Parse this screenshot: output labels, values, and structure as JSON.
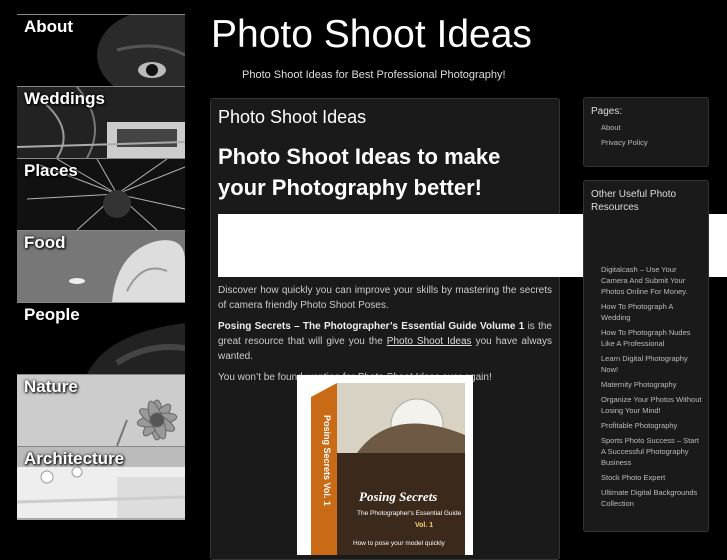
{
  "site": {
    "title": "Photo Shoot Ideas",
    "tagline": "Photo Shoot Ideas for Best Professional Photography!"
  },
  "leftnav": {
    "items": [
      {
        "label": "About",
        "icon": "eye-photo"
      },
      {
        "label": "Weddings",
        "icon": "wedding-photo"
      },
      {
        "label": "Places",
        "icon": "city-lights-photo"
      },
      {
        "label": "Food",
        "icon": "food-photo"
      },
      {
        "label": "People",
        "icon": "face-photo"
      },
      {
        "label": "Nature",
        "icon": "flower-photo"
      },
      {
        "label": "Architecture",
        "icon": "ceiling-photo"
      }
    ]
  },
  "main": {
    "post_title": "Photo Shoot Ideas",
    "headline": "Photo Shoot Ideas to make your Photography better!",
    "p1": "Discover how quickly you can improve your skills by mastering the secrets of camera friendly Photo Shoot Poses.",
    "p2_bold": "Posing Secrets – The Photographer’s Essential Guide Volume 1",
    "p2_mid": " is the great resource that will give you the ",
    "p2_link": "Photo Shoot Ideas",
    "p2_end": " you have always wanted.",
    "p3_start": "You won’t be found wanting for ",
    "p3_em": "Photo Shoot Ideas",
    "p3_end": " ever again!",
    "book": {
      "spine": "Posing Secrets Vol. 1",
      "title": "Posing Secrets",
      "subtitle": "The Photographer's Essential Guide",
      "vol": "Vol. 1",
      "tagline": "How to pose your model quickly"
    }
  },
  "sidebar": {
    "pages": {
      "title": "Pages:",
      "items": [
        "About",
        "Privacy Policy"
      ]
    },
    "other": {
      "title": "Other Useful Photo Resources",
      "items": [
        "Digitalcash – Use Your Camera And Submit Your Photos Online For Money.",
        "How To Photograph A Wedding",
        "How To Photograph Nudes Like A Professional",
        "Learn Digital Photography Now!",
        "Maternity Photography",
        "Organize Your Photos Without Losing Your Mind!",
        "Profitable Photography",
        "Sports Photo Success – Start A Successful Photography Business",
        "Stock Photo Expert",
        "Ultimate Digital Backgrounds Collection"
      ]
    }
  }
}
